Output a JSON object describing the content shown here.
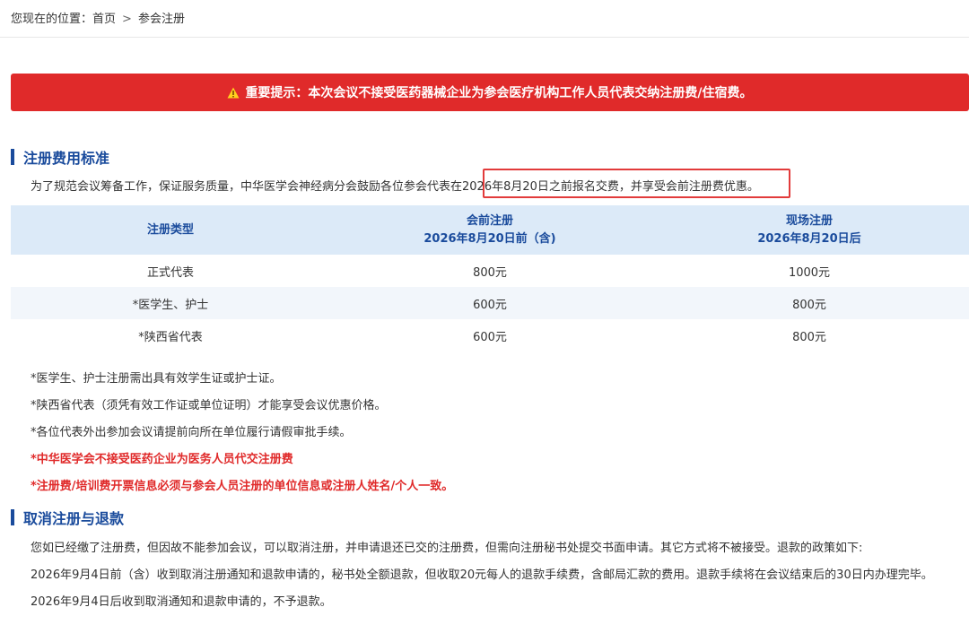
{
  "breadcrumb": {
    "prefix": "您现在的位置：",
    "home": "首页",
    "separator": ">",
    "current": "参会注册"
  },
  "alert": {
    "icon": "warning-triangle-icon",
    "text": "重要提示：本次会议不接受医药器械企业为参会医疗机构工作人员代表交纳注册费/住宿费。",
    "color": "#e02a2a"
  },
  "fee_section": {
    "title": "注册费用标准",
    "intro_before": "为了规范会议筹备工作，保证服务质量，中华医学会神经病分会鼓励各位参会代表在",
    "intro_highlight": "2026年8月20日之前报名交费，并享受会前注册费优惠。",
    "table": {
      "headers": [
        {
          "line1": "注册类型",
          "line2": ""
        },
        {
          "line1": "会前注册",
          "line2": "2026年8月20日前（含)"
        },
        {
          "line1": "现场注册",
          "line2": "2026年8月20日后"
        }
      ],
      "rows": [
        [
          "正式代表",
          "800元",
          "1000元"
        ],
        [
          "*医学生、护士",
          "600元",
          "800元"
        ],
        [
          "*陕西省代表",
          "600元",
          "800元"
        ]
      ]
    },
    "notes": [
      "*医学生、护士注册需出具有效学生证或护士证。",
      "*陕西省代表（须凭有效工作证或单位证明）才能享受会议优惠价格。",
      "*各位代表外出参加会议请提前向所在单位履行请假审批手续。"
    ],
    "red_notes": [
      "*中华医学会不接受医药企业为医务人员代交注册费",
      "*注册费/培训费开票信息必须与参会人员注册的单位信息或注册人姓名/个人一致。"
    ]
  },
  "cancel_section": {
    "title": "取消注册与退款",
    "paragraphs": [
      "您如已经缴了注册费，但因故不能参加会议，可以取消注册，并申请退还已交的注册费，但需向注册秘书处提交书面申请。其它方式将不被接受。退款的政策如下:",
      "2026年9月4日前（含）收到取消注册通知和退款申请的，秘书处全额退款，但收取20元每人的退款手续费，含邮局汇款的费用。退款手续将在会议结束后的30日内办理完毕。",
      "2026年9月4日后收到取消通知和退款申请的，不予退款。"
    ]
  },
  "colors": {
    "accent": "#1a4b9c",
    "header_bg": "#dceaf8",
    "stripe_bg": "#f2f6fb",
    "highlight_border": "#e23b3b"
  }
}
